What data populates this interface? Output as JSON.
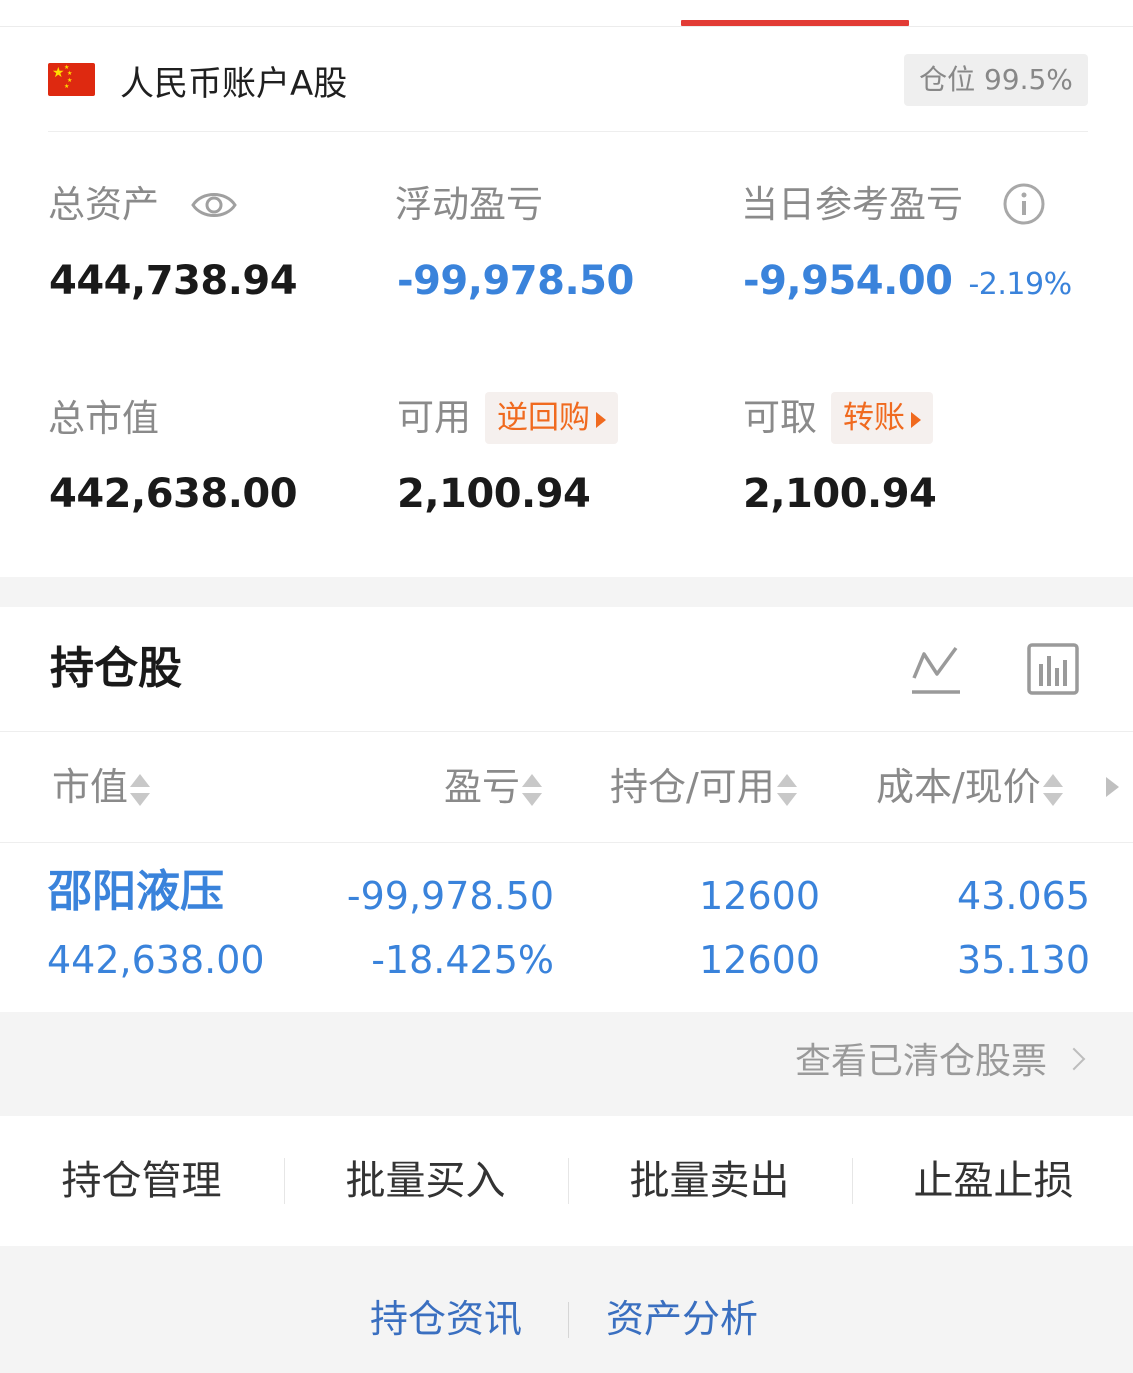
{
  "account": {
    "name": "人民币账户A股",
    "position_badge": "仓位 99.5%"
  },
  "summary": {
    "total_assets_label": "总资产",
    "total_assets_value": "444,738.94",
    "floating_pl_label": "浮动盈亏",
    "floating_pl_value": "-99,978.50",
    "daily_pl_label": "当日参考盈亏",
    "daily_pl_value": "-9,954.00",
    "daily_pl_pct": "-2.19%",
    "market_value_label": "总市值",
    "market_value_value": "442,638.00",
    "available_label": "可用",
    "available_tag": "逆回购",
    "available_value": "2,100.94",
    "withdrawable_label": "可取",
    "withdrawable_tag": "转账",
    "withdrawable_value": "2,100.94"
  },
  "holdings": {
    "title": "持仓股",
    "columns": [
      "市值",
      "盈亏",
      "持仓/可用",
      "成本/现价"
    ],
    "rows": [
      {
        "name": "邵阳液压",
        "market_value": "442,638.00",
        "pl": "-99,978.50",
        "pl_pct": "-18.425%",
        "position": "12600",
        "available": "12600",
        "cost": "43.065",
        "price": "35.130"
      }
    ],
    "cleared_link": "查看已清仓股票"
  },
  "actions": [
    "持仓管理",
    "批量买入",
    "批量卖出",
    "止盈止损"
  ],
  "bottom_links": [
    "持仓资讯",
    "资产分析"
  ],
  "colors": {
    "accent_red": "#e23b35",
    "loss_blue": "#3a83db",
    "tag_orange": "#f06a1f"
  },
  "icons": [
    "eye-icon",
    "info-icon",
    "trend-chart-icon",
    "bar-chart-icon",
    "sort-icon",
    "chevron-right-icon",
    "china-flag-icon"
  ]
}
